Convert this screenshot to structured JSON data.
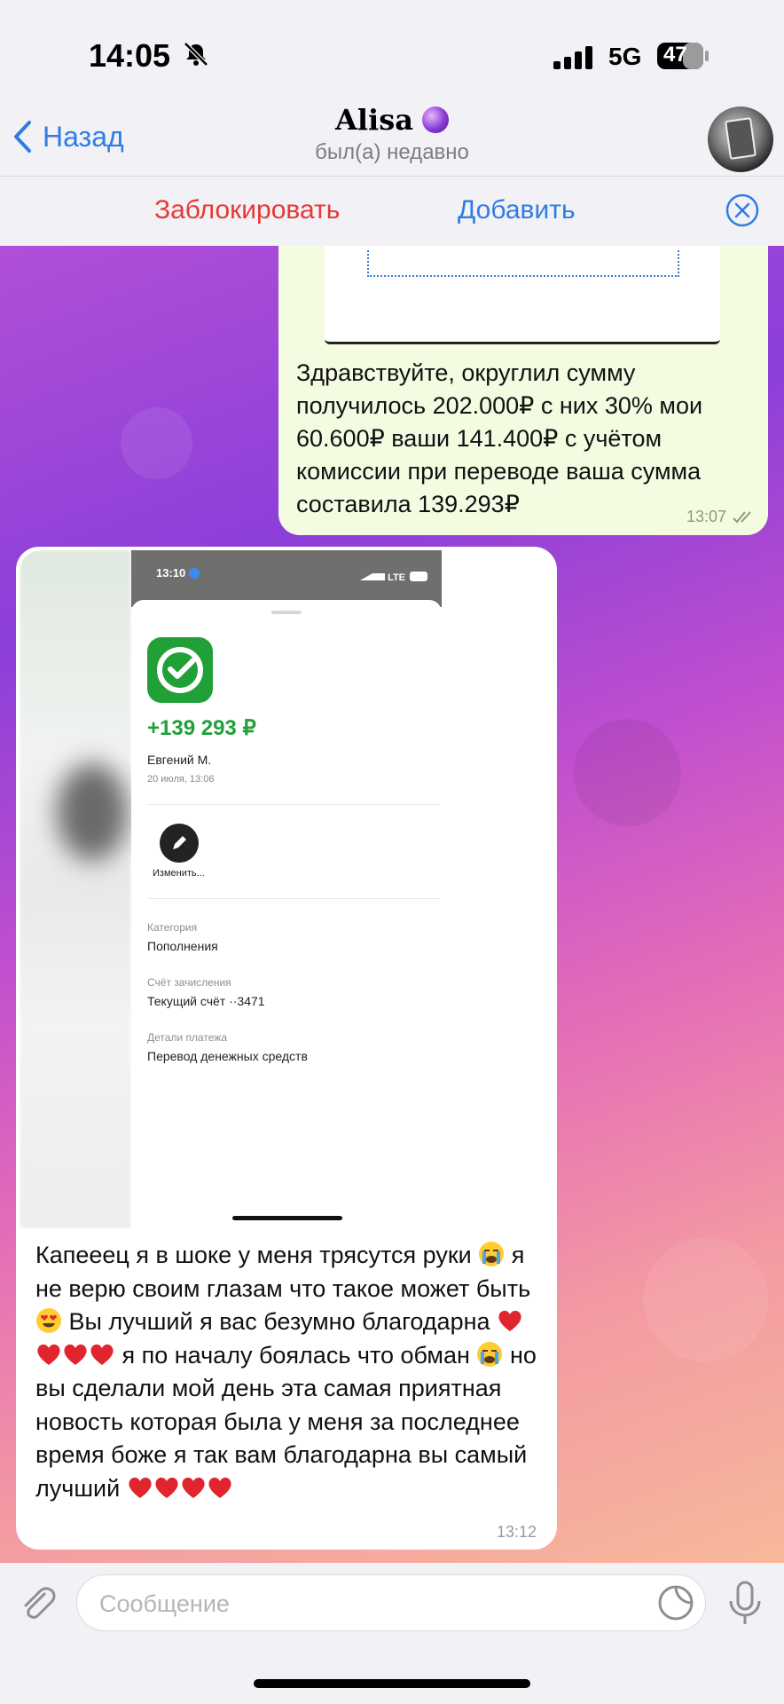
{
  "status_bar": {
    "time": "14:05",
    "network": "5G",
    "battery": "47"
  },
  "header": {
    "back_label": "Назад",
    "contact_name": "Alisa",
    "contact_status": "был(а) недавно",
    "block_label": "Заблокировать",
    "add_label": "Добавить"
  },
  "messages": [
    {
      "direction": "outgoing",
      "text": "Здравствуйте, округлил сумму\nполучилось 202.000₽ с них 30% мои\n60.600₽ ваши 141.400₽ с учётом\nкомиссии при переводе ваша сумма\nсоставила 139.293₽",
      "time": "13:07",
      "read": true
    },
    {
      "direction": "incoming",
      "screenshot": {
        "status_time": "13:10",
        "status_network": "LTE",
        "amount": "+139 293 ₽",
        "sender": "Евгений М.",
        "date": "20 июля, 13:06",
        "edit_label": "Изменить...",
        "fields": [
          {
            "label": "Категория",
            "value": "Пополнения"
          },
          {
            "label": "Счёт зачисления",
            "value": "Текущий счёт ··3471"
          },
          {
            "label": "Детали платежа",
            "value": "Перевод денежных средств"
          }
        ]
      },
      "text_parts": {
        "p1": "Капееец я в шоке у меня трясутся руки",
        "p2": "я не верю своим глазам что такое может быть",
        "p3": "Вы лучший я вас безумно благодарна",
        "p4": "я  по началу боялась что обман",
        "p5": "но вы сделали мой день эта самая приятная новость которая была у меня за последнее время боже я так вам благодарна вы самый лучший"
      },
      "time": "13:12"
    }
  ],
  "composer": {
    "placeholder": "Сообщение"
  },
  "colors": {
    "accent": "#2f7de1",
    "danger": "#e53935",
    "outgoing_bubble": "#f3fbe1",
    "sber_green": "#21a038"
  }
}
